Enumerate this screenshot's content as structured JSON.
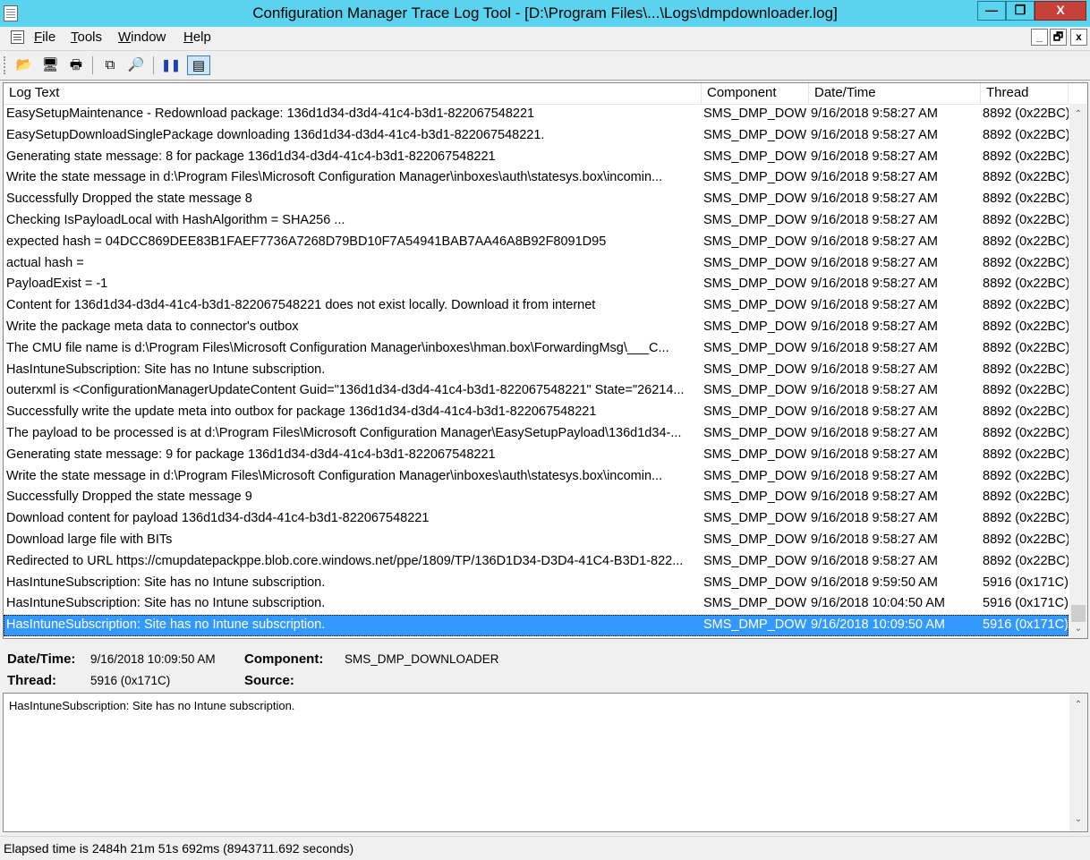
{
  "window": {
    "title": "Configuration Manager Trace Log Tool - [D:\\Program Files\\...\\Logs\\dmpdownloader.log]",
    "minimize_icon": "minimize-icon",
    "maximize_icon": "maximize-icon",
    "close_icon": "close-icon",
    "minimize_glyph": "—",
    "maximize_glyph": "❐",
    "close_glyph": "X"
  },
  "menu": {
    "items": [
      {
        "accel": "F",
        "rest": "ile"
      },
      {
        "accel": "T",
        "rest": "ools"
      },
      {
        "accel": "W",
        "rest": "indow"
      },
      {
        "accel": "H",
        "rest": "elp"
      }
    ],
    "mdi_min": "_",
    "mdi_restore": "🗗",
    "mdi_close": "x"
  },
  "toolbar": {
    "open_icon": "📂",
    "print_preview_icon": "🖥",
    "print_icon": "🖶",
    "copy_icon": "⧉",
    "find_icon": "🔎",
    "pause_icon": "❚❚",
    "highlight_icon": "▤"
  },
  "columns": {
    "log_text": "Log Text",
    "component": "Component",
    "datetime": "Date/Time",
    "thread": "Thread"
  },
  "rows": [
    {
      "text": "EasySetupMaintenance - Redownload package: 136d1d34-d3d4-41c4-b3d1-822067548221",
      "component": "SMS_DMP_DOWNLOADER",
      "datetime": "9/16/2018 9:58:27 AM",
      "thread": "8892 (0x22BC)"
    },
    {
      "text": "EasySetupDownloadSinglePackage downloading 136d1d34-d3d4-41c4-b3d1-822067548221.",
      "component": "SMS_DMP_DOWNLOADER",
      "datetime": "9/16/2018 9:58:27 AM",
      "thread": "8892 (0x22BC)"
    },
    {
      "text": "Generating state message: 8 for package 136d1d34-d3d4-41c4-b3d1-822067548221",
      "component": "SMS_DMP_DOWNLOADER",
      "datetime": "9/16/2018 9:58:27 AM",
      "thread": "8892 (0x22BC)"
    },
    {
      "text": "Write the state message in d:\\Program Files\\Microsoft Configuration Manager\\inboxes\\auth\\statesys.box\\incomin...",
      "component": "SMS_DMP_DOWNLOADER",
      "datetime": "9/16/2018 9:58:27 AM",
      "thread": "8892 (0x22BC)"
    },
    {
      "text": "Successfully Dropped the state message 8",
      "component": "SMS_DMP_DOWNLOADER",
      "datetime": "9/16/2018 9:58:27 AM",
      "thread": "8892 (0x22BC)"
    },
    {
      "text": "Checking IsPayloadLocal with HashAlgorithm = SHA256 ...",
      "component": "SMS_DMP_DOWNLOADER",
      "datetime": "9/16/2018 9:58:27 AM",
      "thread": "8892 (0x22BC)"
    },
    {
      "text": "expected hash = 04DCC869DEE83B1FAEF7736A7268D79BD10F7A54941BAB7AA46A8B92F8091D95",
      "component": "SMS_DMP_DOWNLOADER",
      "datetime": "9/16/2018 9:58:27 AM",
      "thread": "8892 (0x22BC)"
    },
    {
      "text": "actual hash =",
      "component": "SMS_DMP_DOWNLOADER",
      "datetime": "9/16/2018 9:58:27 AM",
      "thread": "8892 (0x22BC)"
    },
    {
      "text": "PayloadExist = -1",
      "component": "SMS_DMP_DOWNLOADER",
      "datetime": "9/16/2018 9:58:27 AM",
      "thread": "8892 (0x22BC)"
    },
    {
      "text": "Content for 136d1d34-d3d4-41c4-b3d1-822067548221 does not exist locally. Download it from internet",
      "component": "SMS_DMP_DOWNLOADER",
      "datetime": "9/16/2018 9:58:27 AM",
      "thread": "8892 (0x22BC)"
    },
    {
      "text": "Write the package meta data to connector's outbox",
      "component": "SMS_DMP_DOWNLOADER",
      "datetime": "9/16/2018 9:58:27 AM",
      "thread": "8892 (0x22BC)"
    },
    {
      "text": "The CMU file name is d:\\Program Files\\Microsoft Configuration Manager\\inboxes\\hman.box\\ForwardingMsg\\___C...",
      "component": "SMS_DMP_DOWNLOADER",
      "datetime": "9/16/2018 9:58:27 AM",
      "thread": "8892 (0x22BC)"
    },
    {
      "text": "HasIntuneSubscription: Site has no Intune subscription.",
      "component": "SMS_DMP_DOWNLOADER",
      "datetime": "9/16/2018 9:58:27 AM",
      "thread": "8892 (0x22BC)"
    },
    {
      "text": "outerxml is <ConfigurationManagerUpdateContent Guid=\"136d1d34-d3d4-41c4-b3d1-822067548221\" State=\"26214...",
      "component": "SMS_DMP_DOWNLOADER",
      "datetime": "9/16/2018 9:58:27 AM",
      "thread": "8892 (0x22BC)"
    },
    {
      "text": "Successfully write the update meta into outbox for package 136d1d34-d3d4-41c4-b3d1-822067548221",
      "component": "SMS_DMP_DOWNLOADER",
      "datetime": "9/16/2018 9:58:27 AM",
      "thread": "8892 (0x22BC)"
    },
    {
      "text": "The payload to be processed is at d:\\Program Files\\Microsoft Configuration Manager\\EasySetupPayload\\136d1d34-...",
      "component": "SMS_DMP_DOWNLOADER",
      "datetime": "9/16/2018 9:58:27 AM",
      "thread": "8892 (0x22BC)"
    },
    {
      "text": "Generating state message: 9 for package 136d1d34-d3d4-41c4-b3d1-822067548221",
      "component": "SMS_DMP_DOWNLOADER",
      "datetime": "9/16/2018 9:58:27 AM",
      "thread": "8892 (0x22BC)"
    },
    {
      "text": "Write the state message in d:\\Program Files\\Microsoft Configuration Manager\\inboxes\\auth\\statesys.box\\incomin...",
      "component": "SMS_DMP_DOWNLOADER",
      "datetime": "9/16/2018 9:58:27 AM",
      "thread": "8892 (0x22BC)"
    },
    {
      "text": "Successfully Dropped the state message 9",
      "component": "SMS_DMP_DOWNLOADER",
      "datetime": "9/16/2018 9:58:27 AM",
      "thread": "8892 (0x22BC)"
    },
    {
      "text": "Download content for payload 136d1d34-d3d4-41c4-b3d1-822067548221",
      "component": "SMS_DMP_DOWNLOADER",
      "datetime": "9/16/2018 9:58:27 AM",
      "thread": "8892 (0x22BC)"
    },
    {
      "text": "Download large file with BITs",
      "component": "SMS_DMP_DOWNLOADER",
      "datetime": "9/16/2018 9:58:27 AM",
      "thread": "8892 (0x22BC)"
    },
    {
      "text": "Redirected to URL https://cmupdatepackppe.blob.core.windows.net/ppe/1809/TP/136D1D34-D3D4-41C4-B3D1-822...",
      "component": "SMS_DMP_DOWNLOADER",
      "datetime": "9/16/2018 9:58:27 AM",
      "thread": "8892 (0x22BC)"
    },
    {
      "text": "HasIntuneSubscription: Site has no Intune subscription.",
      "component": "SMS_DMP_DOWNLOADER",
      "datetime": "9/16/2018 9:59:50 AM",
      "thread": "5916 (0x171C)"
    },
    {
      "text": "HasIntuneSubscription: Site has no Intune subscription.",
      "component": "SMS_DMP_DOWNLOADER",
      "datetime": "9/16/2018 10:04:50 AM",
      "thread": "5916 (0x171C)"
    },
    {
      "text": "HasIntuneSubscription: Site has no Intune subscription.",
      "component": "SMS_DMP_DOWNLOADER",
      "datetime": "9/16/2018 10:09:50 AM",
      "thread": "5916 (0x171C)",
      "selected": true
    }
  ],
  "scroll": {
    "up": "⌃",
    "down": "⌄"
  },
  "details": {
    "datetime_label": "Date/Time:",
    "datetime_value": "9/16/2018 10:09:50 AM",
    "component_label": "Component:",
    "component_value": "SMS_DMP_DOWNLOADER",
    "thread_label": "Thread:",
    "thread_value": "5916 (0x171C)",
    "source_label": "Source:",
    "source_value": ""
  },
  "message_text": "HasIntuneSubscription: Site has no Intune subscription.",
  "status": "Elapsed time is 2484h 21m 51s 692ms (8943711.692 seconds)",
  "colors": {
    "titlebar": "#5bd3ee",
    "selection": "#3399ff",
    "close_button": "#c7413b"
  }
}
